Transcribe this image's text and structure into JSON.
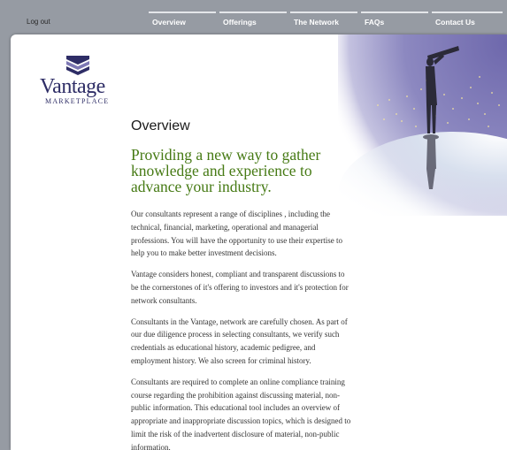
{
  "header": {
    "logout_label": "Log out",
    "nav": [
      "Overview",
      "Offerings",
      "The Network",
      "FAQs",
      "Contact Us"
    ]
  },
  "logo": {
    "name": "Vantage",
    "subtitle": "MARKETPLACE",
    "colors": {
      "brand": "#2e2d66",
      "mark_light": "#7d78b4"
    }
  },
  "main": {
    "title": "Overview",
    "headline": "Providing a new way to gather knowledge and experience to advance your industry.",
    "paragraphs": [
      "Our consultants represent a range of disciplines , including the technical, financial, marketing, operational and managerial professions. You will have the opportunity to use their expertise to help you to make better investment decisions.",
      "Vantage considers honest, compliant and transparent discussions to be the cornerstones of it's offering to investors and it's protection for network consultants.",
      "Consultants in the Vantage, network are carefully chosen. As part of our due diligence process in selecting consultants, we verify such credentials as educational history, academic pedigree, and employment history. We also screen for criminal history.",
      "Consultants are required to complete an online compliance training course regarding the prohibition against discussing material, non-public information. This educational tool includes an overview of appropriate and inappropriate discussion topics, which is designed to limit the risk of the inadvertent disclosure of material, non-public information."
    ]
  },
  "colors": {
    "page_bg": "#969ba3",
    "headline": "#467a14",
    "art_sky": "#7d78b4"
  }
}
